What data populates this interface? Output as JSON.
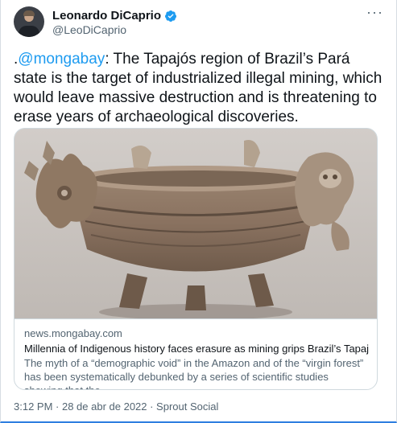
{
  "author": {
    "name": "Leonardo DiCaprio",
    "handle": "@LeoDiCaprio",
    "verified": true,
    "avatar_icon": "profile-photo"
  },
  "menu": {
    "more_label": "···"
  },
  "tweet": {
    "prefix": ".",
    "mention": "@mongabay",
    "body": ": The Tapajós region of Brazil’s Pará state is the target of industrialized illegal mining, which would leave massive destruction and is threatening to erase years of archaeological discoveries."
  },
  "card": {
    "image_alt": "Ancient ceramic vessel with carved figures",
    "domain": "news.mongabay.com",
    "title": "Millennia of Indigenous history faces erasure as mining grips Brazil’s Tapajós",
    "description": "The myth of a “demographic void” in the Amazon and of the “virgin forest” has been systematically debunked by a series of scientific studies showing that the ..."
  },
  "meta": {
    "timestamp": "3:12 PM · 28 de abr de 2022 · Sprout Social"
  },
  "colors": {
    "accent": "#1d9bf0",
    "text": "#0f1419",
    "muted": "#536471",
    "border": "#cfd9de"
  }
}
